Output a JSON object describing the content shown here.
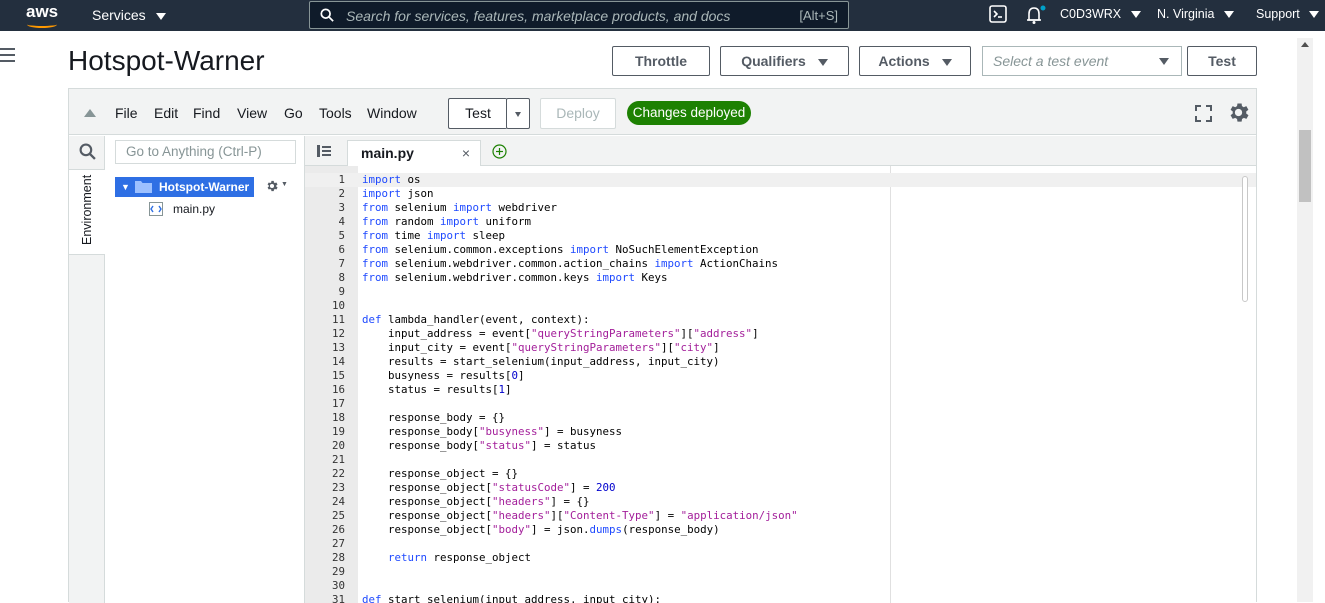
{
  "topnav": {
    "logo": "aws",
    "services": "Services",
    "search_placeholder": "Search for services, features, marketplace products, and docs",
    "search_shortcut": "[Alt+S]",
    "account": "C0D3WRX",
    "region": "N. Virginia",
    "support": "Support"
  },
  "page": {
    "title": "Hotspot-Warner",
    "buttons": {
      "throttle": "Throttle",
      "qualifiers": "Qualifiers",
      "actions": "Actions",
      "test": "Test"
    },
    "test_event_placeholder": "Select a test event"
  },
  "ide": {
    "menu": [
      "File",
      "Edit",
      "Find",
      "View",
      "Go",
      "Tools",
      "Window"
    ],
    "test_label": "Test",
    "deploy_label": "Deploy",
    "status_badge": "Changes deployed",
    "sidebar_tab": "Environment",
    "goto_placeholder": "Go to Anything (Ctrl-P)",
    "folder": "Hotspot-Warner - /",
    "file": "main.py",
    "tab": "main.py"
  },
  "code": {
    "lines": [
      "import os",
      "import json",
      "from selenium import webdriver",
      "from random import uniform",
      "from time import sleep",
      "from selenium.common.exceptions import NoSuchElementException",
      "from selenium.webdriver.common.action_chains import ActionChains",
      "from selenium.webdriver.common.keys import Keys",
      "",
      "",
      "def lambda_handler(event, context):",
      "    input_address = event[\"queryStringParameters\"][\"address\"]",
      "    input_city = event[\"queryStringParameters\"][\"city\"]",
      "    results = start_selenium(input_address, input_city)",
      "    busyness = results[0]",
      "    status = results[1]",
      "",
      "    response_body = {}",
      "    response_body[\"busyness\"] = busyness",
      "    response_body[\"status\"] = status",
      "",
      "    response_object = {}",
      "    response_object[\"statusCode\"] = 200",
      "    response_object[\"headers\"] = {}",
      "    response_object[\"headers\"][\"Content-Type\"] = \"application/json\"",
      "    response_object[\"body\"] = json.dumps(response_body)",
      "",
      "    return response_object",
      "",
      "",
      "def start_selenium(input_address, input_city):"
    ]
  },
  "colors": {
    "nav": "#232f3e",
    "accent": "#ff9900",
    "deployed": "#1d8102",
    "folder_highlight": "#2e6fe4"
  },
  "icons": [
    "search-icon",
    "cloudshell-icon",
    "bell-icon",
    "hamburger-icon",
    "fullscreen-icon",
    "gear-icon",
    "folder-icon",
    "python-file-icon",
    "add-tab-icon",
    "file-list-icon"
  ]
}
